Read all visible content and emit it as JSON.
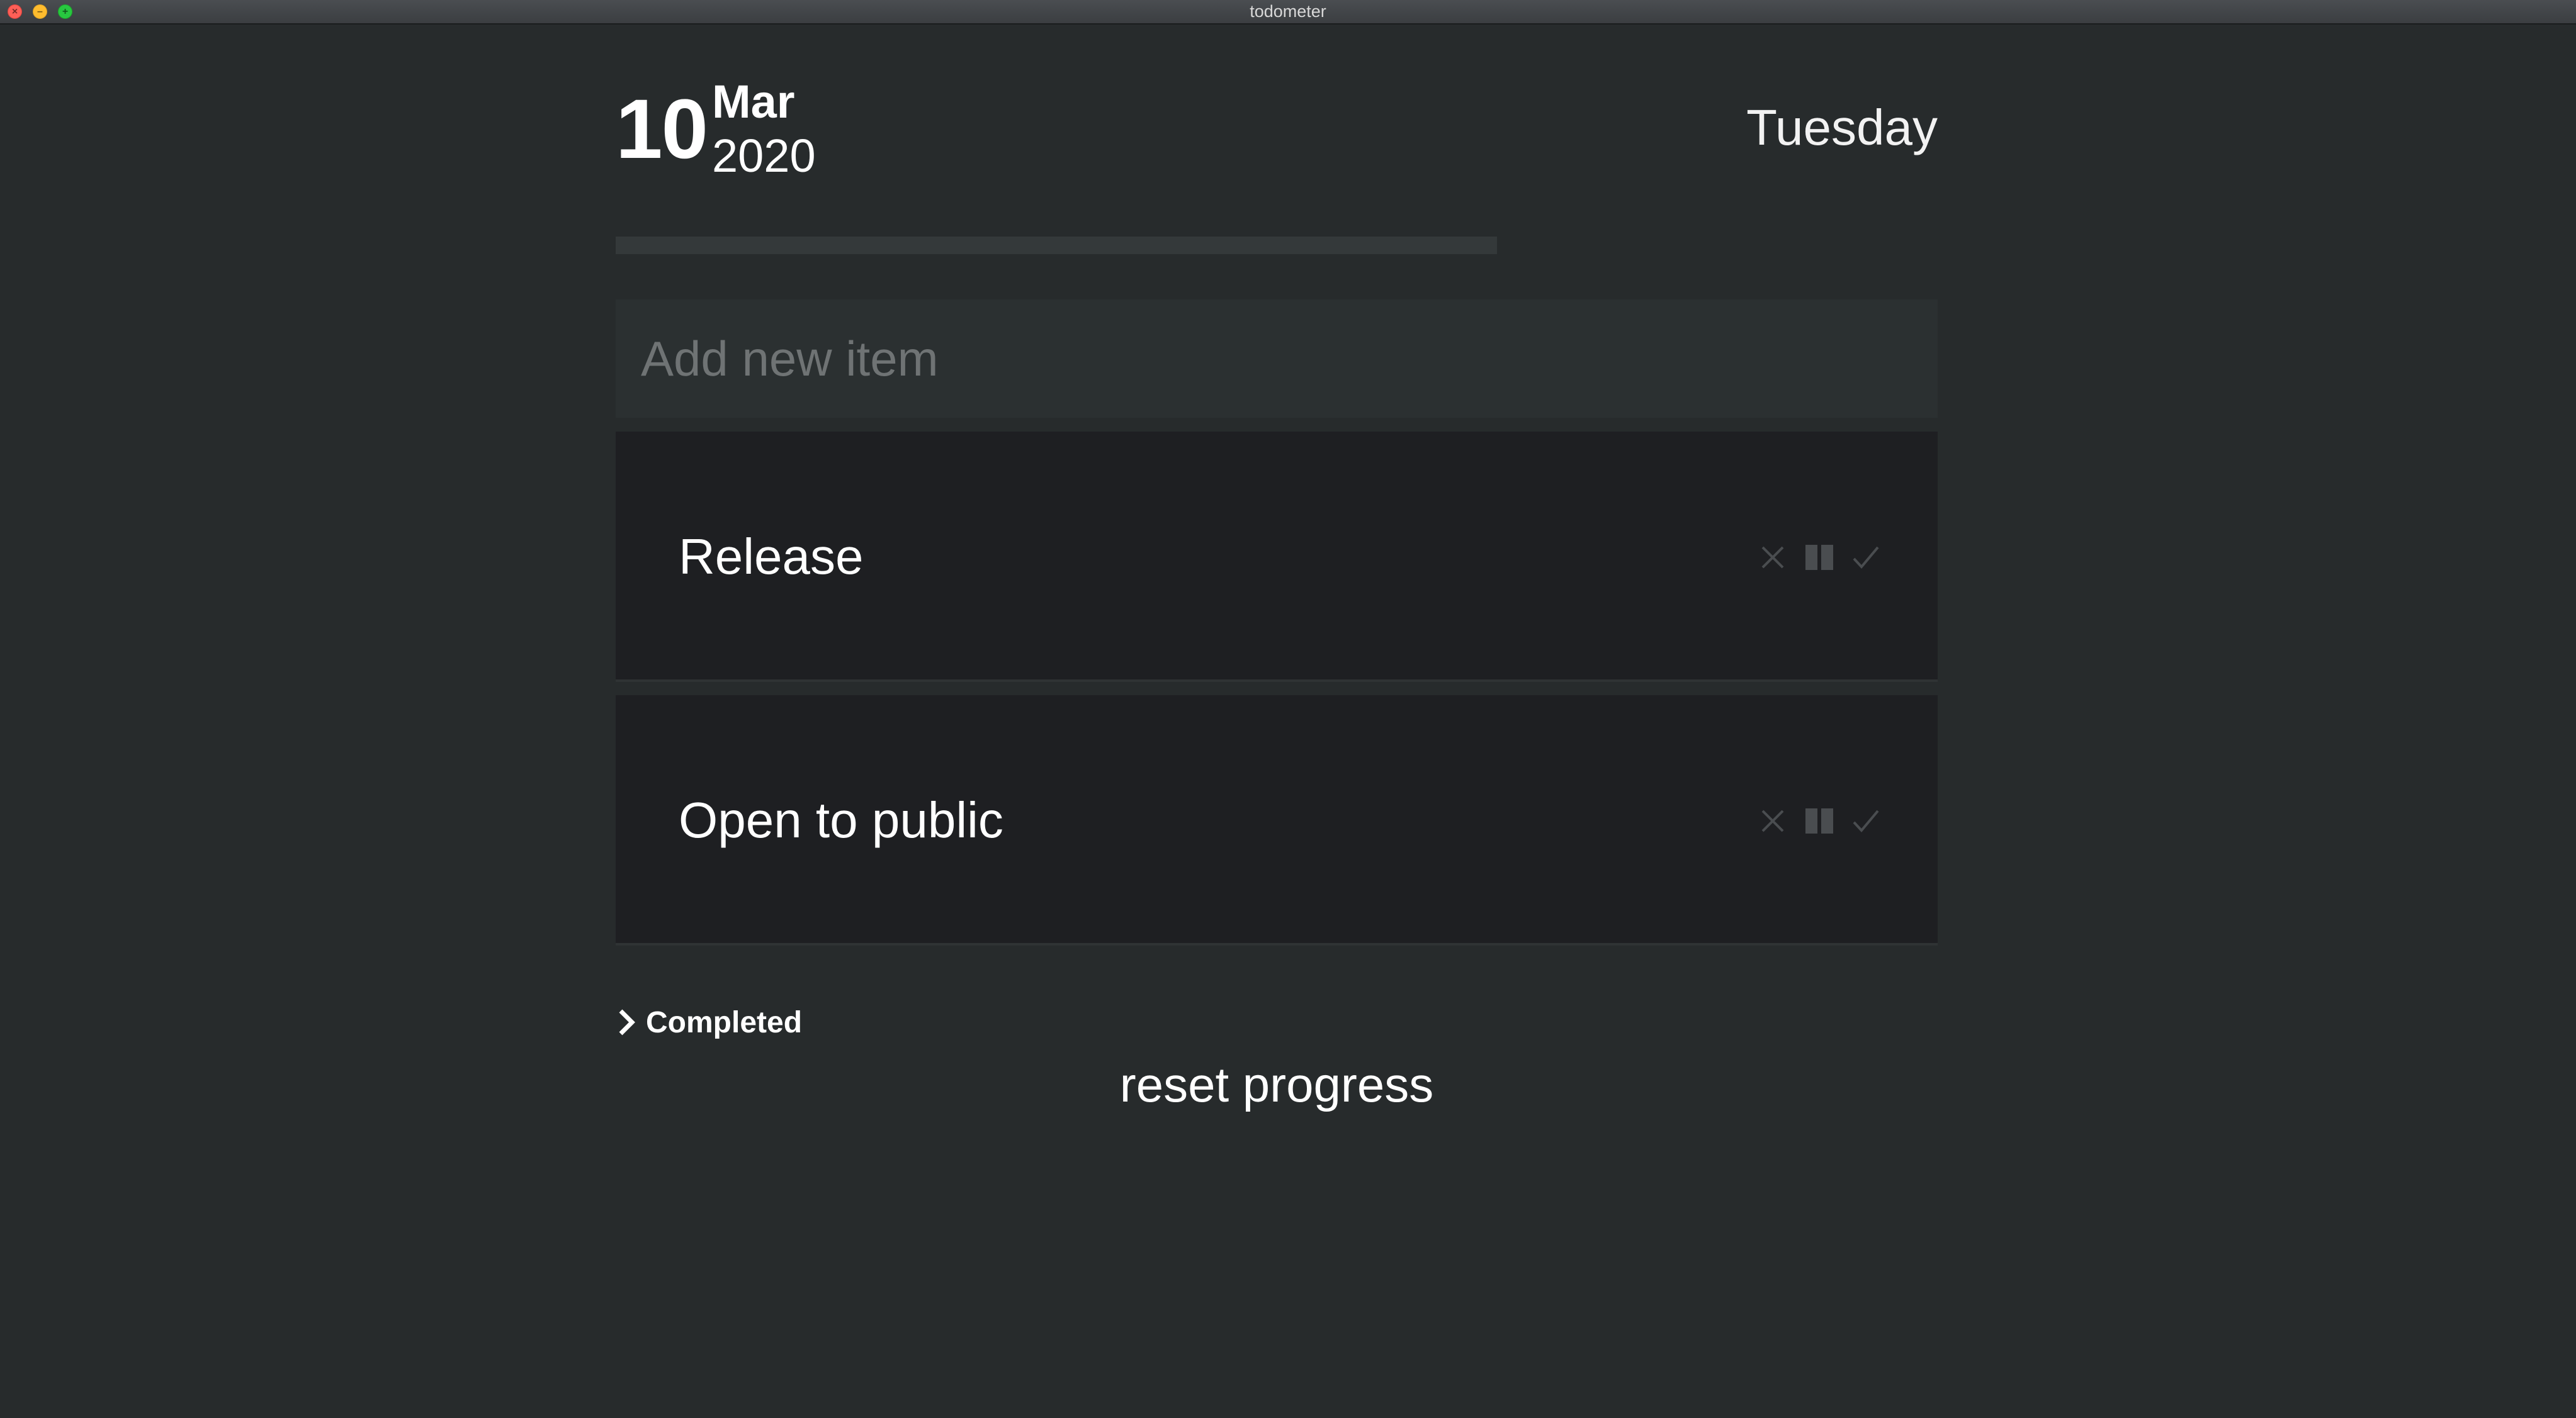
{
  "window": {
    "title": "todometer"
  },
  "header": {
    "day": "10",
    "month": "Mar",
    "year": "2020",
    "weekday": "Tuesday"
  },
  "progress": {
    "completed_fraction": 0
  },
  "add_item": {
    "placeholder": "Add new item",
    "value": ""
  },
  "items": [
    {
      "text": "Release"
    },
    {
      "text": "Open to public"
    }
  ],
  "item_actions": {
    "icons": [
      "close-icon",
      "pause-icon",
      "check-icon"
    ]
  },
  "completed": {
    "label": "Completed",
    "icon": "chevron-right-icon",
    "expanded": false
  },
  "reset": {
    "label": "reset progress"
  },
  "colors": {
    "background": "#272b2c",
    "item_background": "#1e1f22",
    "progress_track": "#34393a",
    "input_background": "#2b3031",
    "action_icon": "#4a4d50",
    "placeholder": "#6f7374"
  }
}
